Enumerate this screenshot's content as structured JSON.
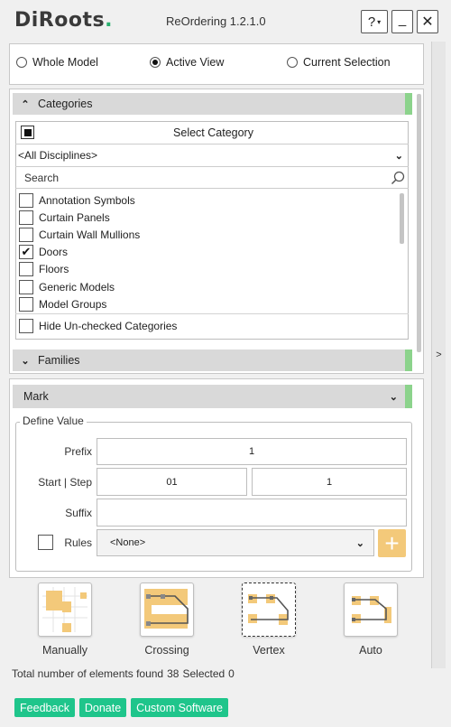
{
  "app": {
    "logo_text": "DiRoots",
    "title": "ReOrdering 1.2.1.0",
    "help_label": "?",
    "minimize_label": "_",
    "close_label": "✕",
    "sidebar_arrow": ">"
  },
  "scope": {
    "options": [
      {
        "label": "Whole Model",
        "selected": false
      },
      {
        "label": "Active View",
        "selected": true
      },
      {
        "label": "Current Selection",
        "selected": false
      }
    ]
  },
  "categories": {
    "header": "Categories",
    "select_label": "Select Category",
    "discipline_value": "<All Disciplines>",
    "search_placeholder": "Search",
    "items": [
      {
        "label": "Annotation Symbols",
        "checked": false
      },
      {
        "label": "Curtain Panels",
        "checked": false
      },
      {
        "label": "Curtain Wall Mullions",
        "checked": false
      },
      {
        "label": "Doors",
        "checked": true
      },
      {
        "label": "Floors",
        "checked": false
      },
      {
        "label": "Generic Models",
        "checked": false
      },
      {
        "label": "Model Groups",
        "checked": false
      }
    ],
    "hide_unchecked_label": "Hide Un-checked Categories"
  },
  "families": {
    "header": "Families"
  },
  "parameter": {
    "selected": "Mark"
  },
  "define_value": {
    "legend": "Define Value",
    "prefix_label": "Prefix",
    "prefix_value": "1",
    "start_step_label": "Start | Step",
    "start_value": "01",
    "step_value": "1",
    "suffix_label": "Suffix",
    "suffix_value": "",
    "rules_label": "Rules",
    "rules_value": "<None>",
    "add_rule_symbol": "+"
  },
  "tools": [
    {
      "label": "Manually",
      "selected": false
    },
    {
      "label": "Crossing",
      "selected": false
    },
    {
      "label": "Vertex",
      "selected": true
    },
    {
      "label": "Auto",
      "selected": false
    }
  ],
  "status": {
    "found_label": "Total number of elements found",
    "found_count": "38",
    "selected_label": "Selected",
    "selected_count": "0"
  },
  "footer": {
    "feedback": "Feedback",
    "donate": "Donate",
    "custom": "Custom Software"
  },
  "colors": {
    "accent_green": "#1fc58b",
    "tab_green": "#8cd38c",
    "tool_orange": "#f3c97a"
  }
}
